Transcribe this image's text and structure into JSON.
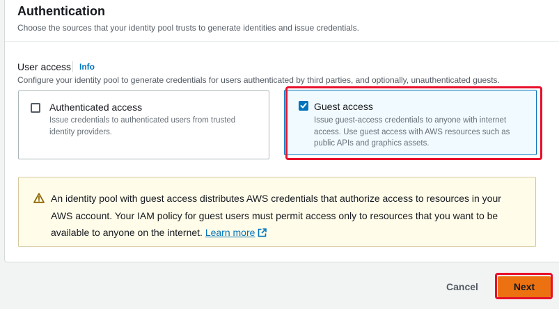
{
  "panel": {
    "title": "Authentication",
    "subtitle": "Choose the sources that your identity pool trusts to generate identities and issue credentials."
  },
  "user_access": {
    "label": "User access",
    "info_link": "Info",
    "description": "Configure your identity pool to generate credentials for users authenticated by third parties, and optionally, unauthenticated guests.",
    "options": [
      {
        "title": "Authenticated access",
        "description": "Issue credentials to authenticated users from trusted identity providers.",
        "checked": false
      },
      {
        "title": "Guest access",
        "description": "Issue guest-access credentials to anyone with internet access. Use guest access with AWS resources such as public APIs and graphics assets.",
        "checked": true
      }
    ]
  },
  "alert": {
    "icon": "warning-icon",
    "text": "An identity pool with guest access distributes AWS credentials that authorize access to resources in your AWS account. Your IAM policy for guest users must permit access only to resources that you want to be available to anyone on the internet.",
    "link_text": "Learn more"
  },
  "footer": {
    "cancel_label": "Cancel",
    "next_label": "Next"
  },
  "colors": {
    "primary_button": "#ec7211",
    "link": "#0073bb",
    "highlight_box": "#e8102b",
    "alert_background": "#fffce9"
  }
}
